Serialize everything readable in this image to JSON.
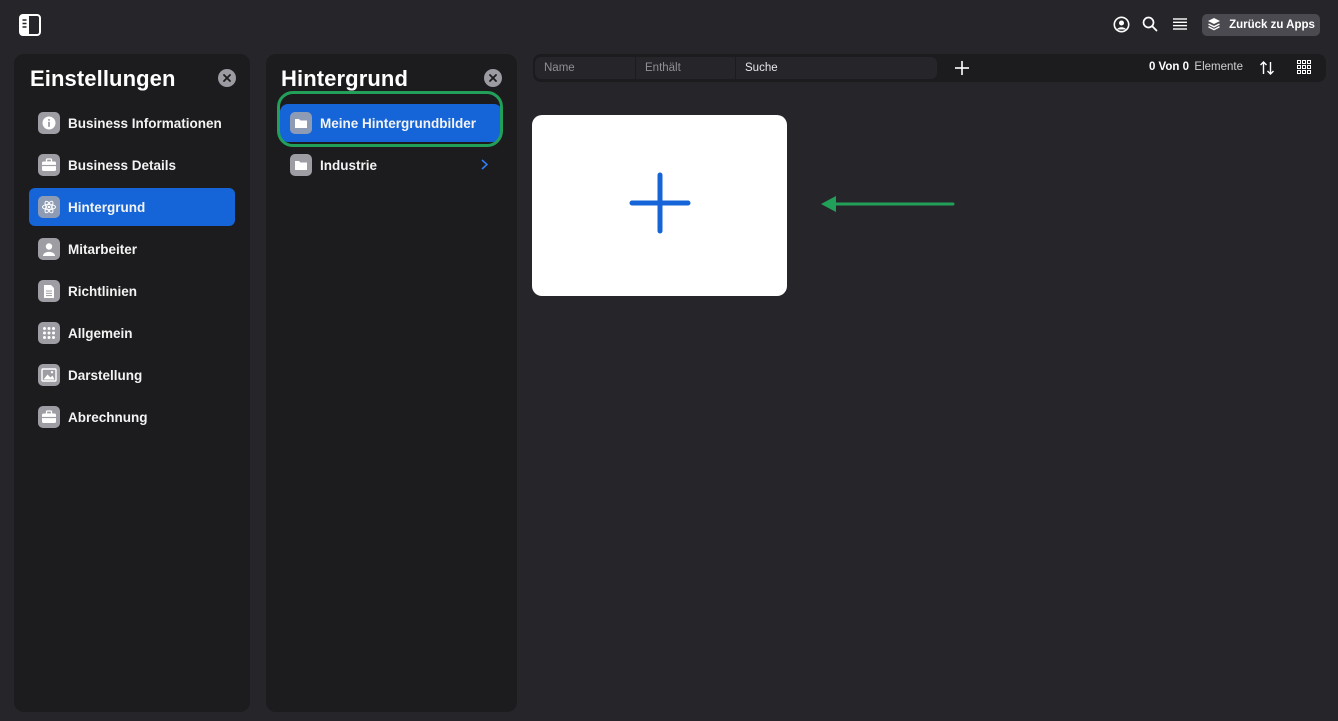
{
  "app": {
    "sidebar_toggle_icon": "sidebar-toggle-icon",
    "header_icons": [
      "user-circle-icon",
      "search-icon",
      "list-menu-icon"
    ],
    "back_button": {
      "label": "Zurück zu Apps",
      "icon": "layers-icon"
    }
  },
  "settings_panel": {
    "title": "Einstellungen",
    "items": [
      {
        "label": "Business Informationen",
        "icon": "info-icon",
        "active": false
      },
      {
        "label": "Business Details",
        "icon": "briefcase-icon",
        "active": false
      },
      {
        "label": "Hintergrund",
        "icon": "atom-icon",
        "active": true
      },
      {
        "label": "Mitarbeiter",
        "icon": "person-icon",
        "active": false
      },
      {
        "label": "Richtlinien",
        "icon": "document-icon",
        "active": false
      },
      {
        "label": "Allgemein",
        "icon": "grid-dots-icon",
        "active": false
      },
      {
        "label": "Darstellung",
        "icon": "image-icon",
        "active": false
      },
      {
        "label": "Abrechnung",
        "icon": "briefcase-icon",
        "active": false
      }
    ]
  },
  "background_panel": {
    "title": "Hintergrund",
    "folders": [
      {
        "label": "Meine Hintergrundbilder",
        "active": true,
        "has_chevron": false
      },
      {
        "label": "Industrie",
        "active": false,
        "has_chevron": true
      }
    ]
  },
  "filter_bar": {
    "columns": [
      "Name",
      "Enthält",
      "Suche"
    ],
    "count": "0 Von 0",
    "count_label": "Elemente"
  },
  "colors": {
    "accent": "#1565d8",
    "annotation_green": "#22a05a",
    "background": "#25252a",
    "panel": "#1c1c1e"
  }
}
